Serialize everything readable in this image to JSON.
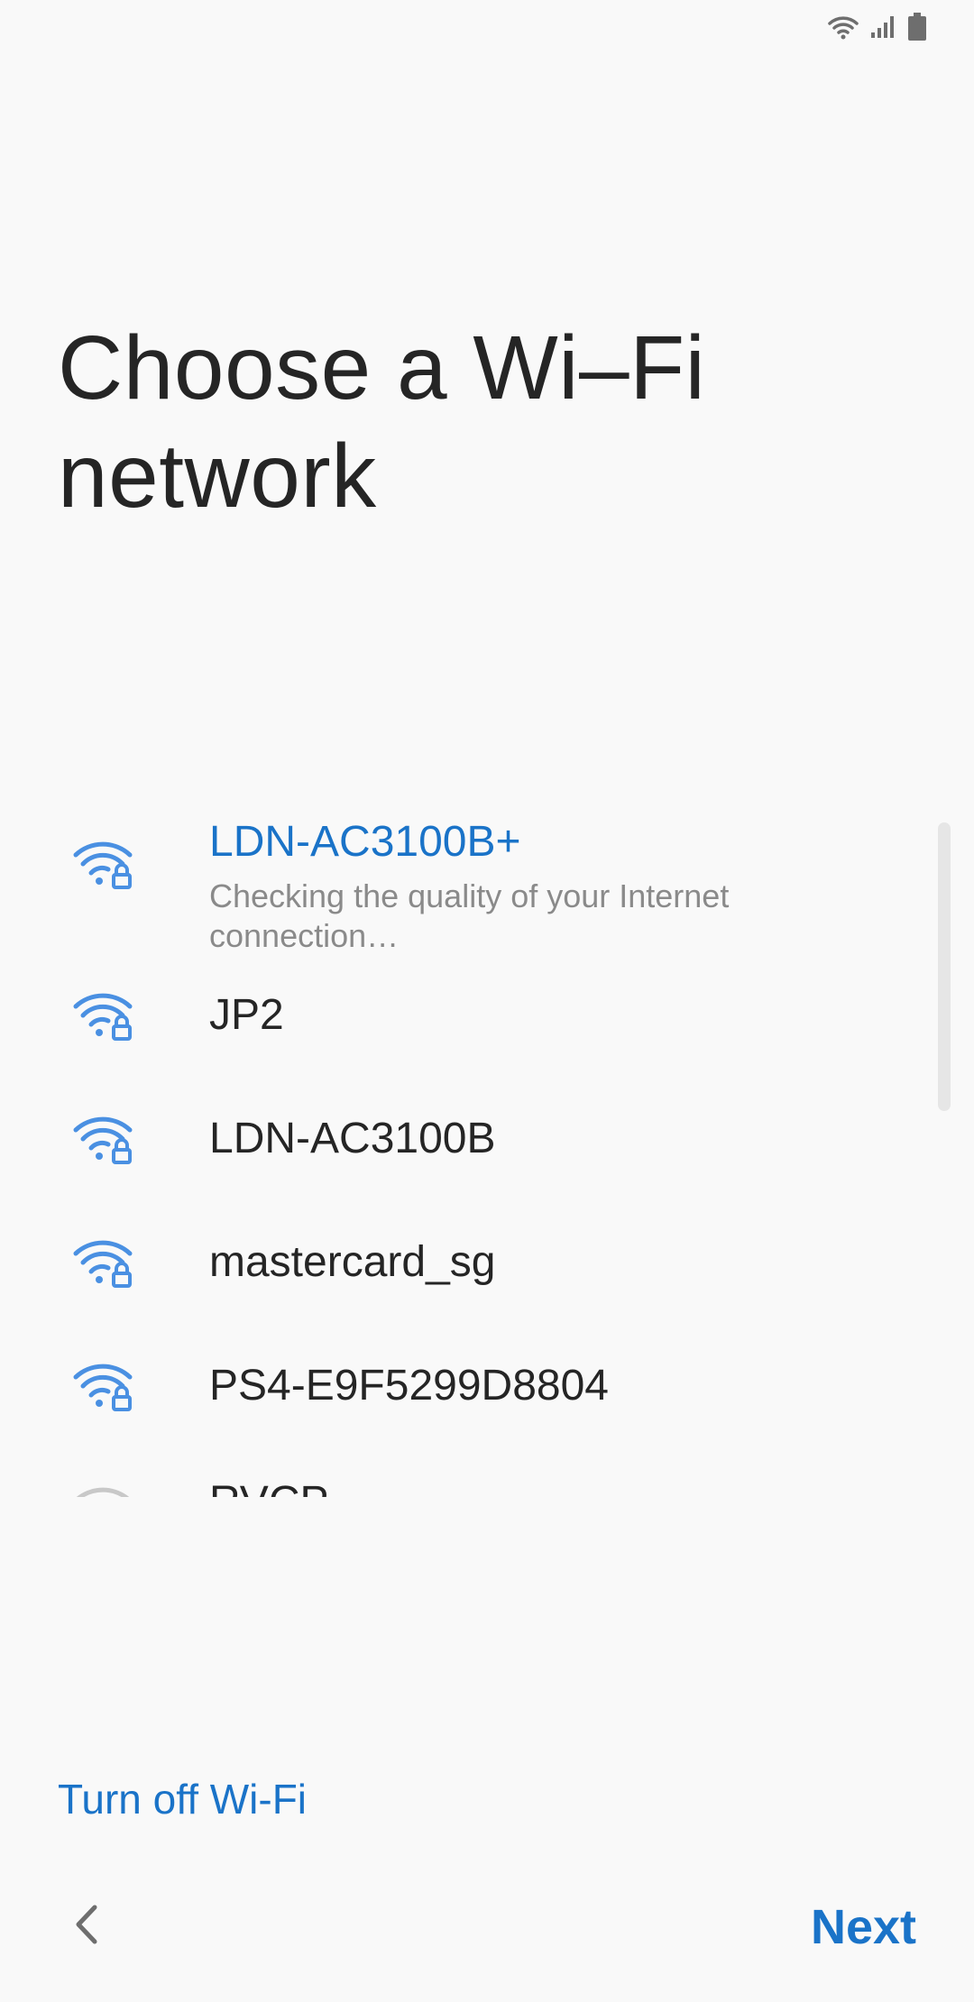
{
  "status_bar": {
    "icons": [
      "wifi-icon",
      "signal-icon",
      "battery-icon"
    ]
  },
  "page": {
    "title": "Choose a Wi–Fi network"
  },
  "networks": [
    {
      "name": "LDN-AC3100B+",
      "status": "Checking the quality of your Internet connection…",
      "secured": true,
      "active": true
    },
    {
      "name": "JP2",
      "secured": true
    },
    {
      "name": "LDN-AC3100B",
      "secured": true
    },
    {
      "name": "mastercard_sg",
      "secured": true
    },
    {
      "name": "PS4-E9F5299D8804",
      "secured": true
    },
    {
      "name": "RVCP",
      "secured": false
    }
  ],
  "actions": {
    "turn_off_wifi": "Turn off Wi-Fi",
    "next": "Next"
  },
  "colors": {
    "accent": "#1a73c8",
    "wifi_icon": "#4a90e2",
    "background": "#f9f9f9"
  }
}
